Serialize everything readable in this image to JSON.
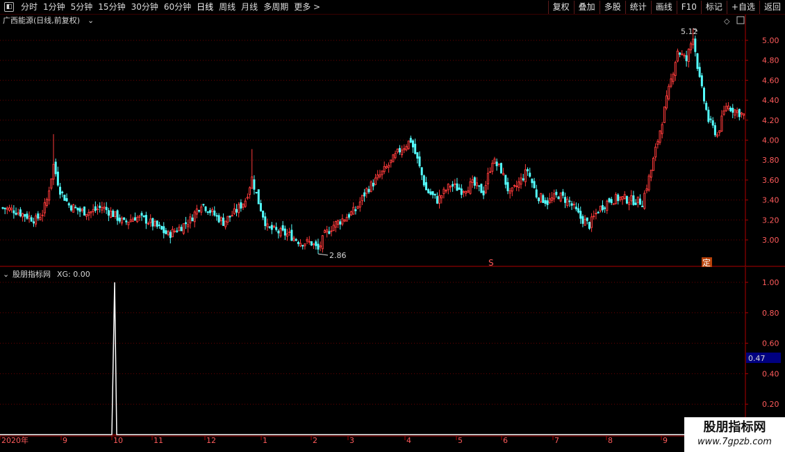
{
  "toolbar": {
    "periods": [
      "分时",
      "1分钟",
      "5分钟",
      "15分钟",
      "30分钟",
      "60分钟",
      "日线",
      "周线",
      "月线",
      "多周期",
      "更多"
    ],
    "active_period": "日线",
    "more_arrow": ">",
    "buttons": [
      "复权",
      "叠加",
      "多股",
      "统计",
      "画线",
      "F10",
      "标记",
      "+自选",
      "返回"
    ]
  },
  "main_panel": {
    "title": "广西能源(日线,前复权)",
    "high_label": "5.12",
    "low_label": "2.86",
    "marker_s": "S",
    "marker_ding": "定",
    "y_ticks": [
      "5.00",
      "4.80",
      "4.60",
      "4.40",
      "4.20",
      "4.00",
      "3.80",
      "3.60",
      "3.40",
      "3.20",
      "3.00"
    ]
  },
  "indicator_panel": {
    "title": "股朋指标网",
    "value_text": "XG: 0.00",
    "y_ticks": [
      "1.00",
      "0.80",
      "0.60",
      "0.40",
      "0.20"
    ],
    "current_value": "0.47"
  },
  "x_axis": {
    "labels": [
      "2020年",
      "9",
      "10",
      "11",
      "12",
      "1",
      "2",
      "3",
      "4",
      "5",
      "6",
      "7",
      "8",
      "9"
    ]
  },
  "watermark": {
    "title": "股朋指标网",
    "url": "www.7gpzb.com"
  },
  "colors": {
    "up": "#ff3b3b",
    "down": "#54ffff",
    "grid": "#6e0000",
    "axis": "#b00000",
    "indicator": "#ffffff"
  },
  "chart_data": [
    {
      "type": "candlestick",
      "ylim": [
        2.86,
        5.12
      ],
      "trading_days": 260,
      "close_path": [
        [
          0,
          3.32
        ],
        [
          5,
          3.3
        ],
        [
          10,
          3.25
        ],
        [
          15,
          3.2
        ],
        [
          18,
          3.27
        ],
        [
          20,
          3.4
        ],
        [
          23,
          3.75
        ],
        [
          26,
          3.5
        ],
        [
          30,
          3.35
        ],
        [
          35,
          3.29
        ],
        [
          40,
          3.28
        ],
        [
          45,
          3.33
        ],
        [
          50,
          3.26
        ],
        [
          55,
          3.17
        ],
        [
          60,
          3.23
        ],
        [
          65,
          3.2
        ],
        [
          70,
          3.13
        ],
        [
          75,
          3.05
        ],
        [
          80,
          3.12
        ],
        [
          85,
          3.2
        ],
        [
          90,
          3.37
        ],
        [
          95,
          3.27
        ],
        [
          100,
          3.18
        ],
        [
          105,
          3.27
        ],
        [
          110,
          3.4
        ],
        [
          113,
          3.62
        ],
        [
          116,
          3.38
        ],
        [
          120,
          3.12
        ],
        [
          125,
          3.08
        ],
        [
          130,
          3.05
        ],
        [
          135,
          2.98
        ],
        [
          140,
          2.97
        ],
        [
          143,
          2.9
        ],
        [
          146,
          3.05
        ],
        [
          150,
          3.15
        ],
        [
          155,
          3.22
        ],
        [
          160,
          3.3
        ],
        [
          165,
          3.5
        ],
        [
          170,
          3.62
        ],
        [
          175,
          3.75
        ],
        [
          180,
          3.9
        ],
        [
          185,
          4.0
        ],
        [
          188,
          3.8
        ],
        [
          192,
          3.5
        ],
        [
          197,
          3.4
        ],
        [
          203,
          3.55
        ],
        [
          208,
          3.5
        ],
        [
          213,
          3.56
        ],
        [
          218,
          3.48
        ],
        [
          222,
          3.8
        ],
        [
          226,
          3.7
        ],
        [
          230,
          3.45
        ],
        [
          235,
          3.6
        ],
        [
          238,
          3.7
        ],
        [
          242,
          3.45
        ],
        [
          247,
          3.38
        ],
        [
          252,
          3.45
        ],
        [
          257,
          3.38
        ],
        [
          262,
          3.22
        ],
        [
          266,
          3.15
        ],
        [
          270,
          3.3
        ],
        [
          275,
          3.4
        ],
        [
          280,
          3.42
        ],
        [
          285,
          3.4
        ],
        [
          290,
          3.38
        ],
        [
          294,
          3.7
        ],
        [
          298,
          4.1
        ],
        [
          302,
          4.5
        ],
        [
          306,
          4.9
        ],
        [
          310,
          4.8
        ],
        [
          313,
          5.05
        ],
        [
          316,
          4.6
        ],
        [
          320,
          4.2
        ],
        [
          324,
          4.05
        ],
        [
          328,
          4.35
        ],
        [
          332,
          4.3
        ],
        [
          336,
          4.25
        ]
      ],
      "extremes": {
        "high": 5.12,
        "low": 2.86
      }
    },
    {
      "type": "line",
      "series": [
        {
          "values_description": "spike",
          "spike_value": 1.0,
          "current": 0.0
        }
      ],
      "ylim": [
        0,
        1.08
      ]
    }
  ]
}
